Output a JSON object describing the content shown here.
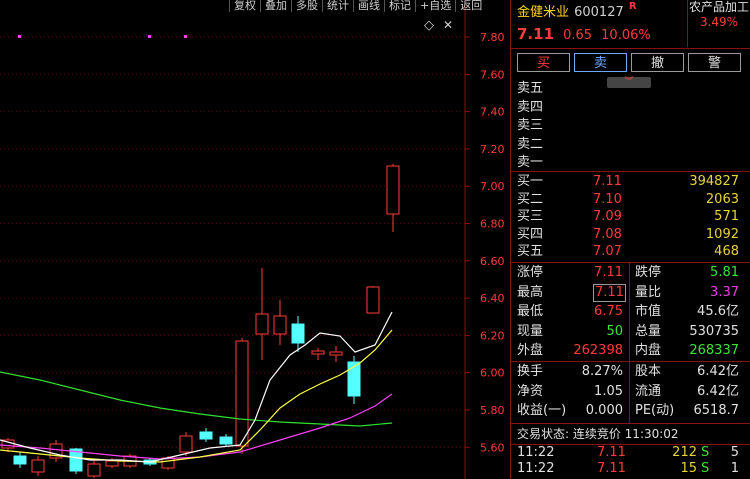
{
  "toolbar": [
    "复权",
    "叠加",
    "多股",
    "统计",
    "画线",
    "标记",
    "+自选",
    "返回"
  ],
  "chart": {
    "price_ticks": [
      "7.80",
      "7.60",
      "7.40",
      "7.20",
      "7.00",
      "6.80",
      "6.60",
      "6.40",
      "6.20",
      "6.00",
      "5.80",
      "5.60"
    ],
    "diamond": "◇",
    "colors": {
      "up": "#ff3b3b",
      "down": "#54ffff",
      "ma5": "#ffffff",
      "ma10": "#ffff40",
      "ma20": "#ff40ff",
      "ma60": "#30e030"
    }
  },
  "stock": {
    "name": "金健米业",
    "code": "600127",
    "badge": "R",
    "price": "7.11",
    "change": "0.65",
    "pct": "10.06%",
    "sector": "农产品加工",
    "sector_pct": "3.49%"
  },
  "actions": {
    "buy": "买",
    "sell": "卖",
    "cancel": "撤",
    "alert": "警"
  },
  "sell_levels": [
    "卖五",
    "卖四",
    "卖三",
    "卖二",
    "卖一"
  ],
  "buy_levels": [
    {
      "label": "买一",
      "price": "7.11",
      "vol": "394827"
    },
    {
      "label": "买二",
      "price": "7.10",
      "vol": "2063"
    },
    {
      "label": "买三",
      "price": "7.09",
      "vol": "571"
    },
    {
      "label": "买四",
      "price": "7.08",
      "vol": "1092"
    },
    {
      "label": "买五",
      "price": "7.07",
      "vol": "468"
    }
  ],
  "stats": [
    {
      "l1": "涨停",
      "v1": "7.11",
      "c1": "red",
      "l2": "跌停",
      "v2": "5.81",
      "c2": "green"
    },
    {
      "l1": "最高",
      "v1": "7.11",
      "c1": "red",
      "l2": "量比",
      "v2": "3.37",
      "c2": "mag"
    },
    {
      "l1": "最低",
      "v1": "6.75",
      "c1": "red",
      "l2": "市值",
      "v2": "45.6亿",
      "c2": "white"
    },
    {
      "l1": "现量",
      "v1": "50",
      "c1": "green",
      "l2": "总量",
      "v2": "530735",
      "c2": "white"
    },
    {
      "l1": "外盘",
      "v1": "262398",
      "c1": "red",
      "l2": "内盘",
      "v2": "268337",
      "c2": "green"
    }
  ],
  "stats2": [
    {
      "l1": "换手",
      "v1": "8.27%",
      "l2": "股本",
      "v2": "6.42亿"
    },
    {
      "l1": "净资",
      "v1": "1.05",
      "l2": "流通",
      "v2": "6.42亿"
    },
    {
      "l1": "收益(一)",
      "v1": "0.000",
      "l2": "PE(动)",
      "v2": "6518.7"
    }
  ],
  "trade_status": "交易状态: 连续竞价 11:30:02",
  "ticks": [
    {
      "time": "11:22",
      "price": "7.11",
      "vol": "212",
      "dir": "S",
      "n": "5"
    },
    {
      "time": "11:22",
      "price": "7.11",
      "vol": "15",
      "dir": "S",
      "n": "1"
    }
  ]
}
